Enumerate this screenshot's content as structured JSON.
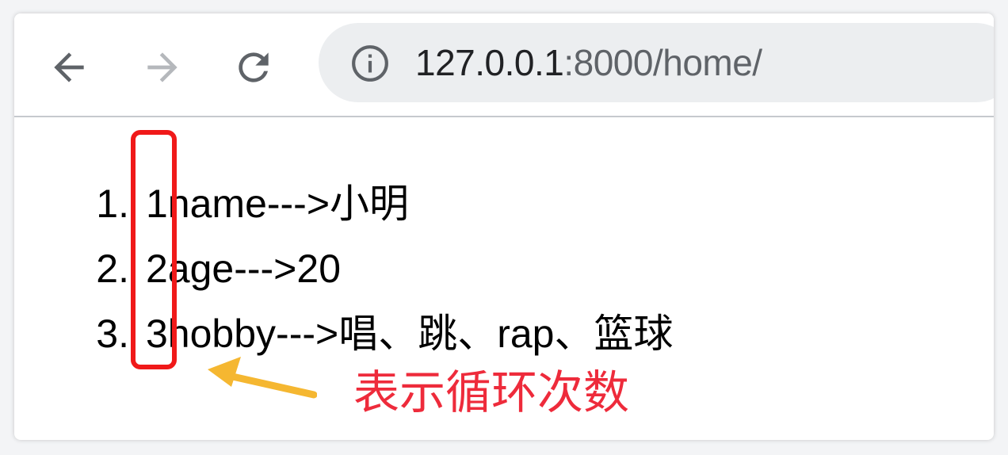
{
  "browser": {
    "address_bar": {
      "url_host": "127.0.0.1",
      "url_rest": ":8000/home/"
    },
    "icons": {
      "back": "arrow-left-icon",
      "forward": "arrow-right-icon",
      "reload": "reload-icon",
      "site_info": "info-icon"
    }
  },
  "page": {
    "list": [
      {
        "marker": "1.",
        "text": "1name--->小明"
      },
      {
        "marker": "2.",
        "text": "2age--->20"
      },
      {
        "marker": "3.",
        "text": "3hobby--->唱、跳、rap、篮球"
      }
    ],
    "annotation": "表示循环次数"
  },
  "colors": {
    "highlight_box": "#f01919",
    "arrow": "#f5b731",
    "annotation_text": "#ee2b3b",
    "forward_disabled": "#b5b8bc",
    "icon_active": "#5f6368"
  }
}
